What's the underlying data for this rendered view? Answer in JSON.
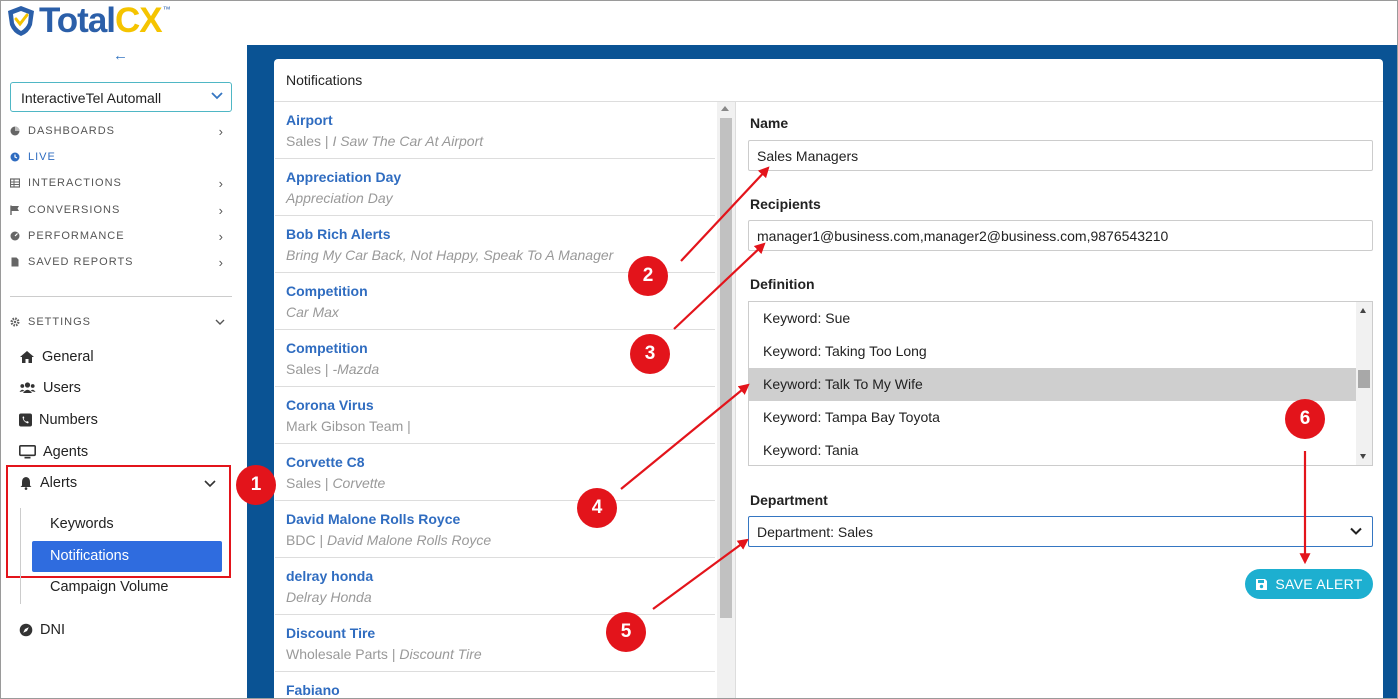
{
  "brand": {
    "name_part1": "Total",
    "name_part2": "CX",
    "trademark": "™"
  },
  "sidebar": {
    "back_arrow": "←",
    "account": "InteractiveTel Automall",
    "nav": [
      {
        "label": "DASHBOARDS",
        "icon": "pie-chart-icon",
        "has_arrow": true
      },
      {
        "label": "LIVE",
        "icon": "clock-icon",
        "has_arrow": false
      },
      {
        "label": "INTERACTIONS",
        "icon": "table-icon",
        "has_arrow": true
      },
      {
        "label": "CONVERSIONS",
        "icon": "flag-icon",
        "has_arrow": true
      },
      {
        "label": "PERFORMANCE",
        "icon": "gauge-icon",
        "has_arrow": true
      },
      {
        "label": "SAVED REPORTS",
        "icon": "file-icon",
        "has_arrow": true
      }
    ],
    "settings_label": "SETTINGS",
    "settings_items": {
      "general": "General",
      "users": "Users",
      "numbers": "Numbers",
      "agents": "Agents",
      "alerts": "Alerts",
      "dni": "DNI"
    },
    "alerts_sub": {
      "keywords": "Keywords",
      "notifications": "Notifications",
      "campaign_volume": "Campaign Volume"
    }
  },
  "panel": {
    "title": "Notifications",
    "list": [
      {
        "title": "Airport",
        "prefix": "Sales | ",
        "detail": "I Saw The Car At Airport"
      },
      {
        "title": "Appreciation Day",
        "prefix": "",
        "detail": "Appreciation Day"
      },
      {
        "title": "Bob Rich Alerts",
        "prefix": "",
        "detail": "Bring My Car Back, Not Happy, Speak To A Manager"
      },
      {
        "title": "Competition",
        "prefix": "",
        "detail": "Car Max"
      },
      {
        "title": "Competition",
        "prefix": "Sales | ",
        "detail": "-Mazda"
      },
      {
        "title": "Corona Virus",
        "prefix": "Mark Gibson Team | ",
        "detail": ""
      },
      {
        "title": "Corvette C8",
        "prefix": "Sales | ",
        "detail": "Corvette"
      },
      {
        "title": "David Malone Rolls Royce",
        "prefix": "BDC | ",
        "detail": "David Malone Rolls Royce"
      },
      {
        "title": "delray honda",
        "prefix": "",
        "detail": "Delray Honda"
      },
      {
        "title": "Discount Tire",
        "prefix": "Wholesale Parts | ",
        "detail": "Discount Tire"
      },
      {
        "title": "Fabiano",
        "prefix": "",
        "detail": ""
      }
    ],
    "form": {
      "name_label": "Name",
      "name_value": "Sales Managers",
      "recipients_label": "Recipients",
      "recipients_value": "manager1@business.com,manager2@business.com,9876543210",
      "definition_label": "Definition",
      "definition_options": [
        "Keyword: Sue",
        "Keyword: Taking Too Long",
        "Keyword: Talk To My Wife",
        "Keyword: Tampa Bay Toyota",
        "Keyword: Tania"
      ],
      "definition_selected_index": 2,
      "department_label": "Department",
      "department_value": "Department: Sales",
      "save_label": "SAVE ALERT"
    }
  },
  "annotations": [
    "1",
    "2",
    "3",
    "4",
    "5",
    "6"
  ],
  "colors": {
    "accent_blue": "#2f6cc0",
    "main_bg": "#0a5394",
    "annotation_red": "#e3141b",
    "save_button": "#1dafd0",
    "active_item": "#2f6cdf"
  }
}
